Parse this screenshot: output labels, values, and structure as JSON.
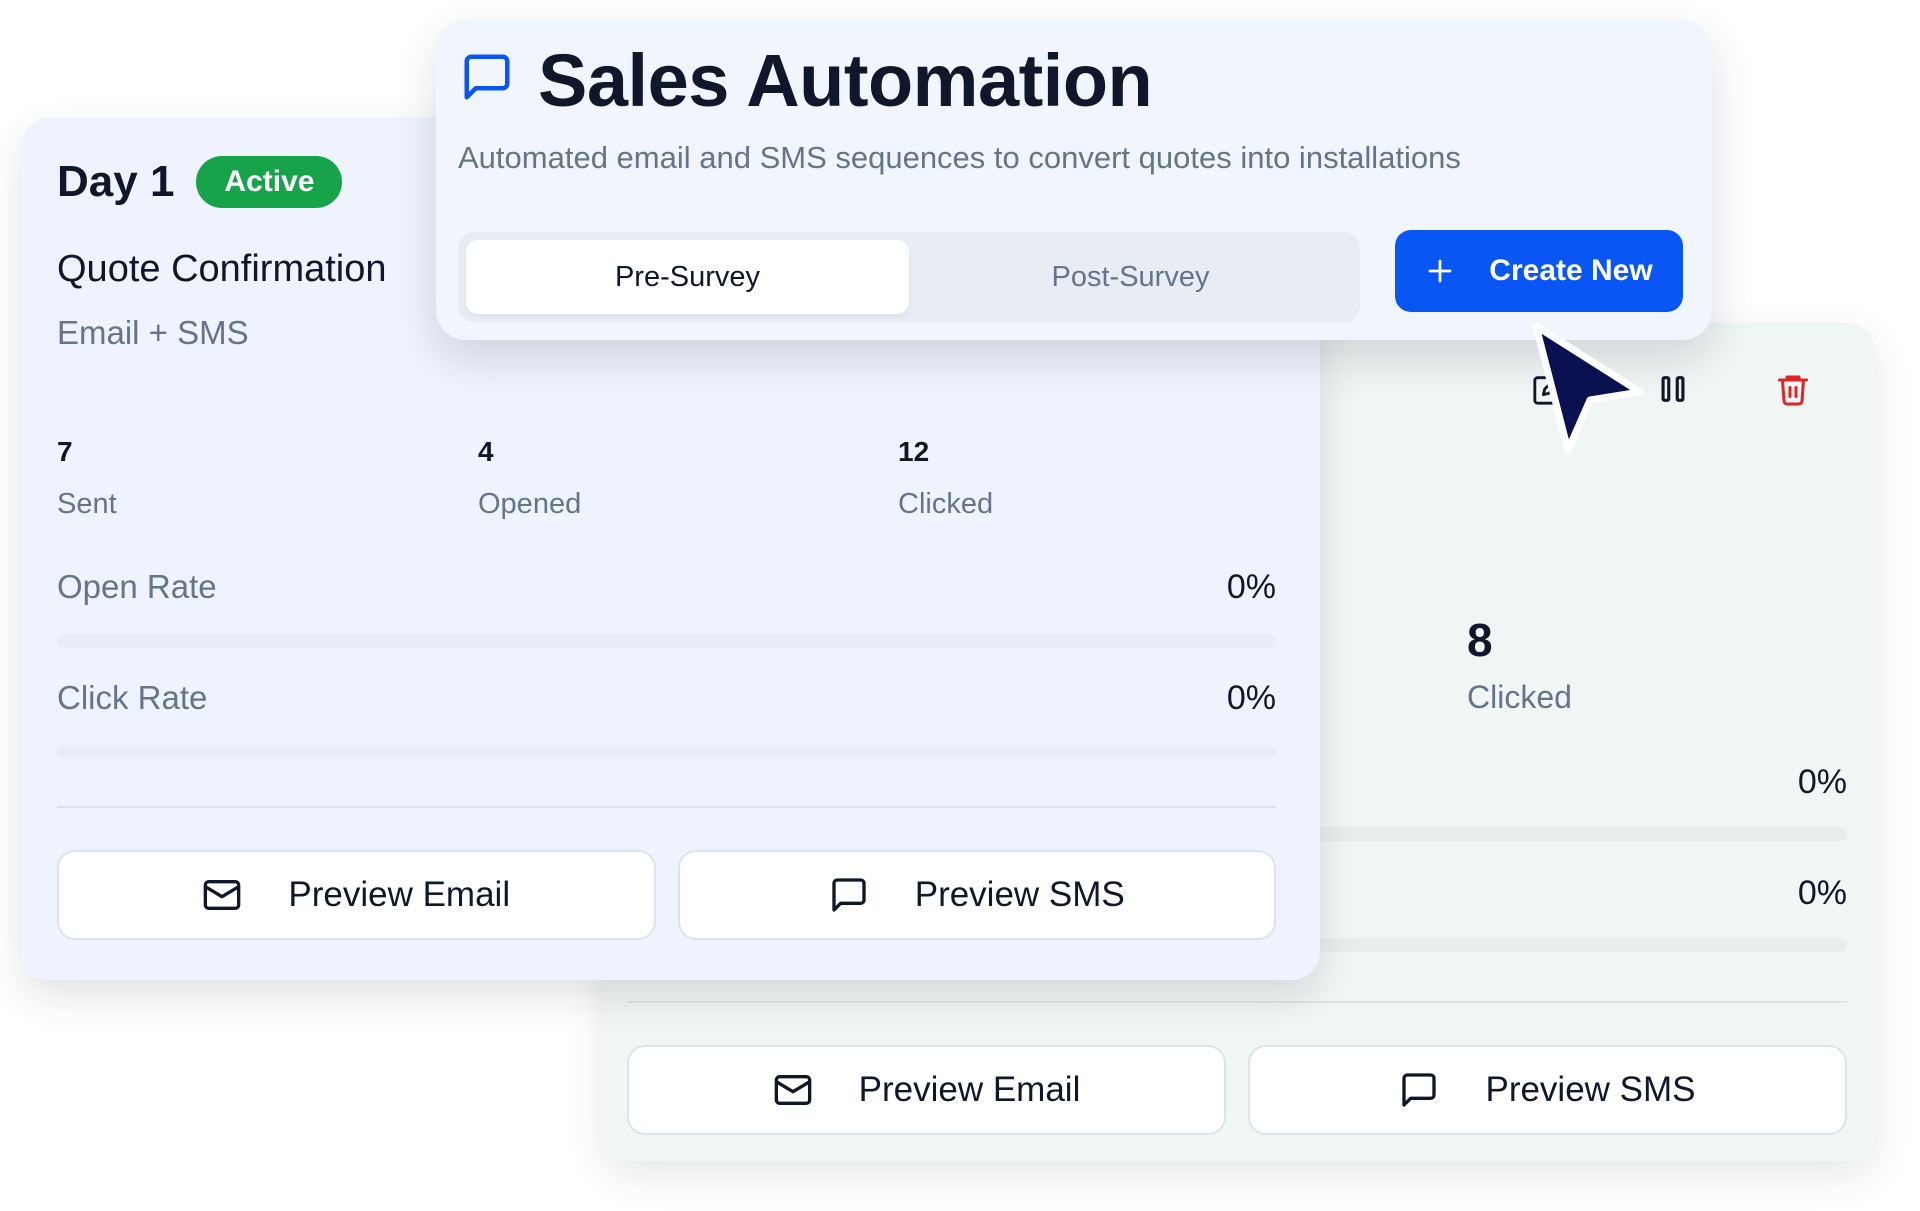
{
  "header": {
    "title": "Sales Automation",
    "subtitle": "Automated email and SMS sequences to convert quotes into installations",
    "tabs": [
      {
        "label": "Pre-Survey",
        "active": true
      },
      {
        "label": "Post-Survey",
        "active": false
      }
    ],
    "create_label": "Create New",
    "accent_color": "#0a56f5"
  },
  "front_card": {
    "day": "Day 1",
    "status": "Active",
    "status_color": "#16a34a",
    "title": "Quote Confirmation",
    "channel": "Email + SMS",
    "stats": [
      {
        "value": "7",
        "label": "Sent"
      },
      {
        "value": "4",
        "label": "Opened"
      },
      {
        "value": "12",
        "label": "Clicked"
      }
    ],
    "open_rate": {
      "label": "Open Rate",
      "value": "0%",
      "fill_percent": 0
    },
    "click_rate": {
      "label": "Click Rate",
      "value": "0%",
      "fill_percent": 0
    },
    "preview_email_label": "Preview Email",
    "preview_sms_label": "Preview SMS"
  },
  "back_card": {
    "clicked_value": "8",
    "clicked_label": "Clicked",
    "open_rate_value": "0%",
    "click_rate_value": "0%",
    "preview_email_label": "Preview Email",
    "preview_sms_label": "Preview SMS",
    "icons": [
      "edit-icon",
      "pause-icon",
      "trash-icon"
    ],
    "trash_color": "#dc2626"
  },
  "cursor": {
    "color": "#0b1150"
  }
}
